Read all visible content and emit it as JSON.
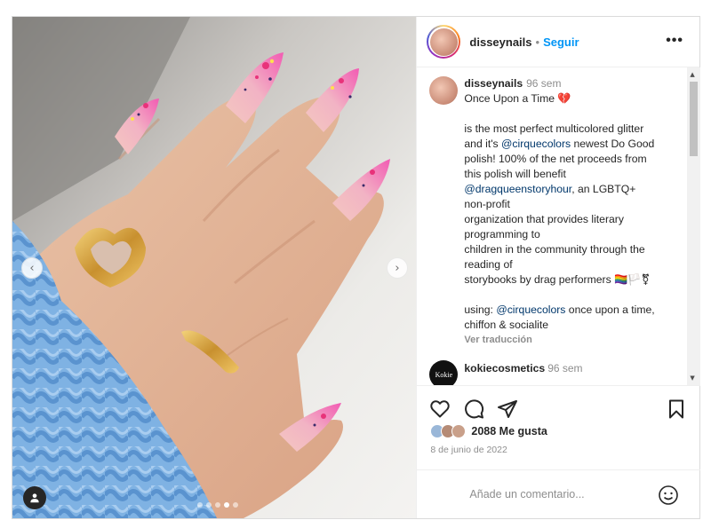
{
  "post": {
    "username": "disseynails",
    "follow_label": "Seguir",
    "more_icon": "more-options-icon",
    "caption": {
      "username": "disseynails",
      "time": "96 sem",
      "title": "Once Upon a Time 💔",
      "line1": "is the most perfect multicolored glitter",
      "line2_pre": "and it's ",
      "line2_mention": "@cirquecolors",
      "line2_post": " newest Do Good",
      "line3": "polish! 100% of the net proceeds from",
      "line4": "this polish will benefit",
      "line5_mention": "@dragqueenstoryhour",
      "line5_post": ", an LGBTQ+",
      "line6": "non-profit",
      "line7": "organization that provides literary",
      "line8": "programming to",
      "line9": "children in the community through the",
      "line10": "reading of",
      "line11": "storybooks by drag performers 🏳️‍🌈🏳️⚧",
      "line12_pre": "using: ",
      "line12_mention": "@cirquecolors",
      "line12_post": " once upon a time,",
      "line13": "chiffon & socialite",
      "translate_label": "Ver traducción"
    },
    "comments": [
      {
        "username": "kokiecosmetics",
        "time": "96 sem",
        "avatar_text": "Kokie"
      }
    ],
    "likes_text": "2088 Me gusta",
    "date": "8 de junio de 2022",
    "comment_placeholder": "Añade un comentario...",
    "carousel": {
      "slide_count": 5,
      "active_index": 3
    }
  }
}
